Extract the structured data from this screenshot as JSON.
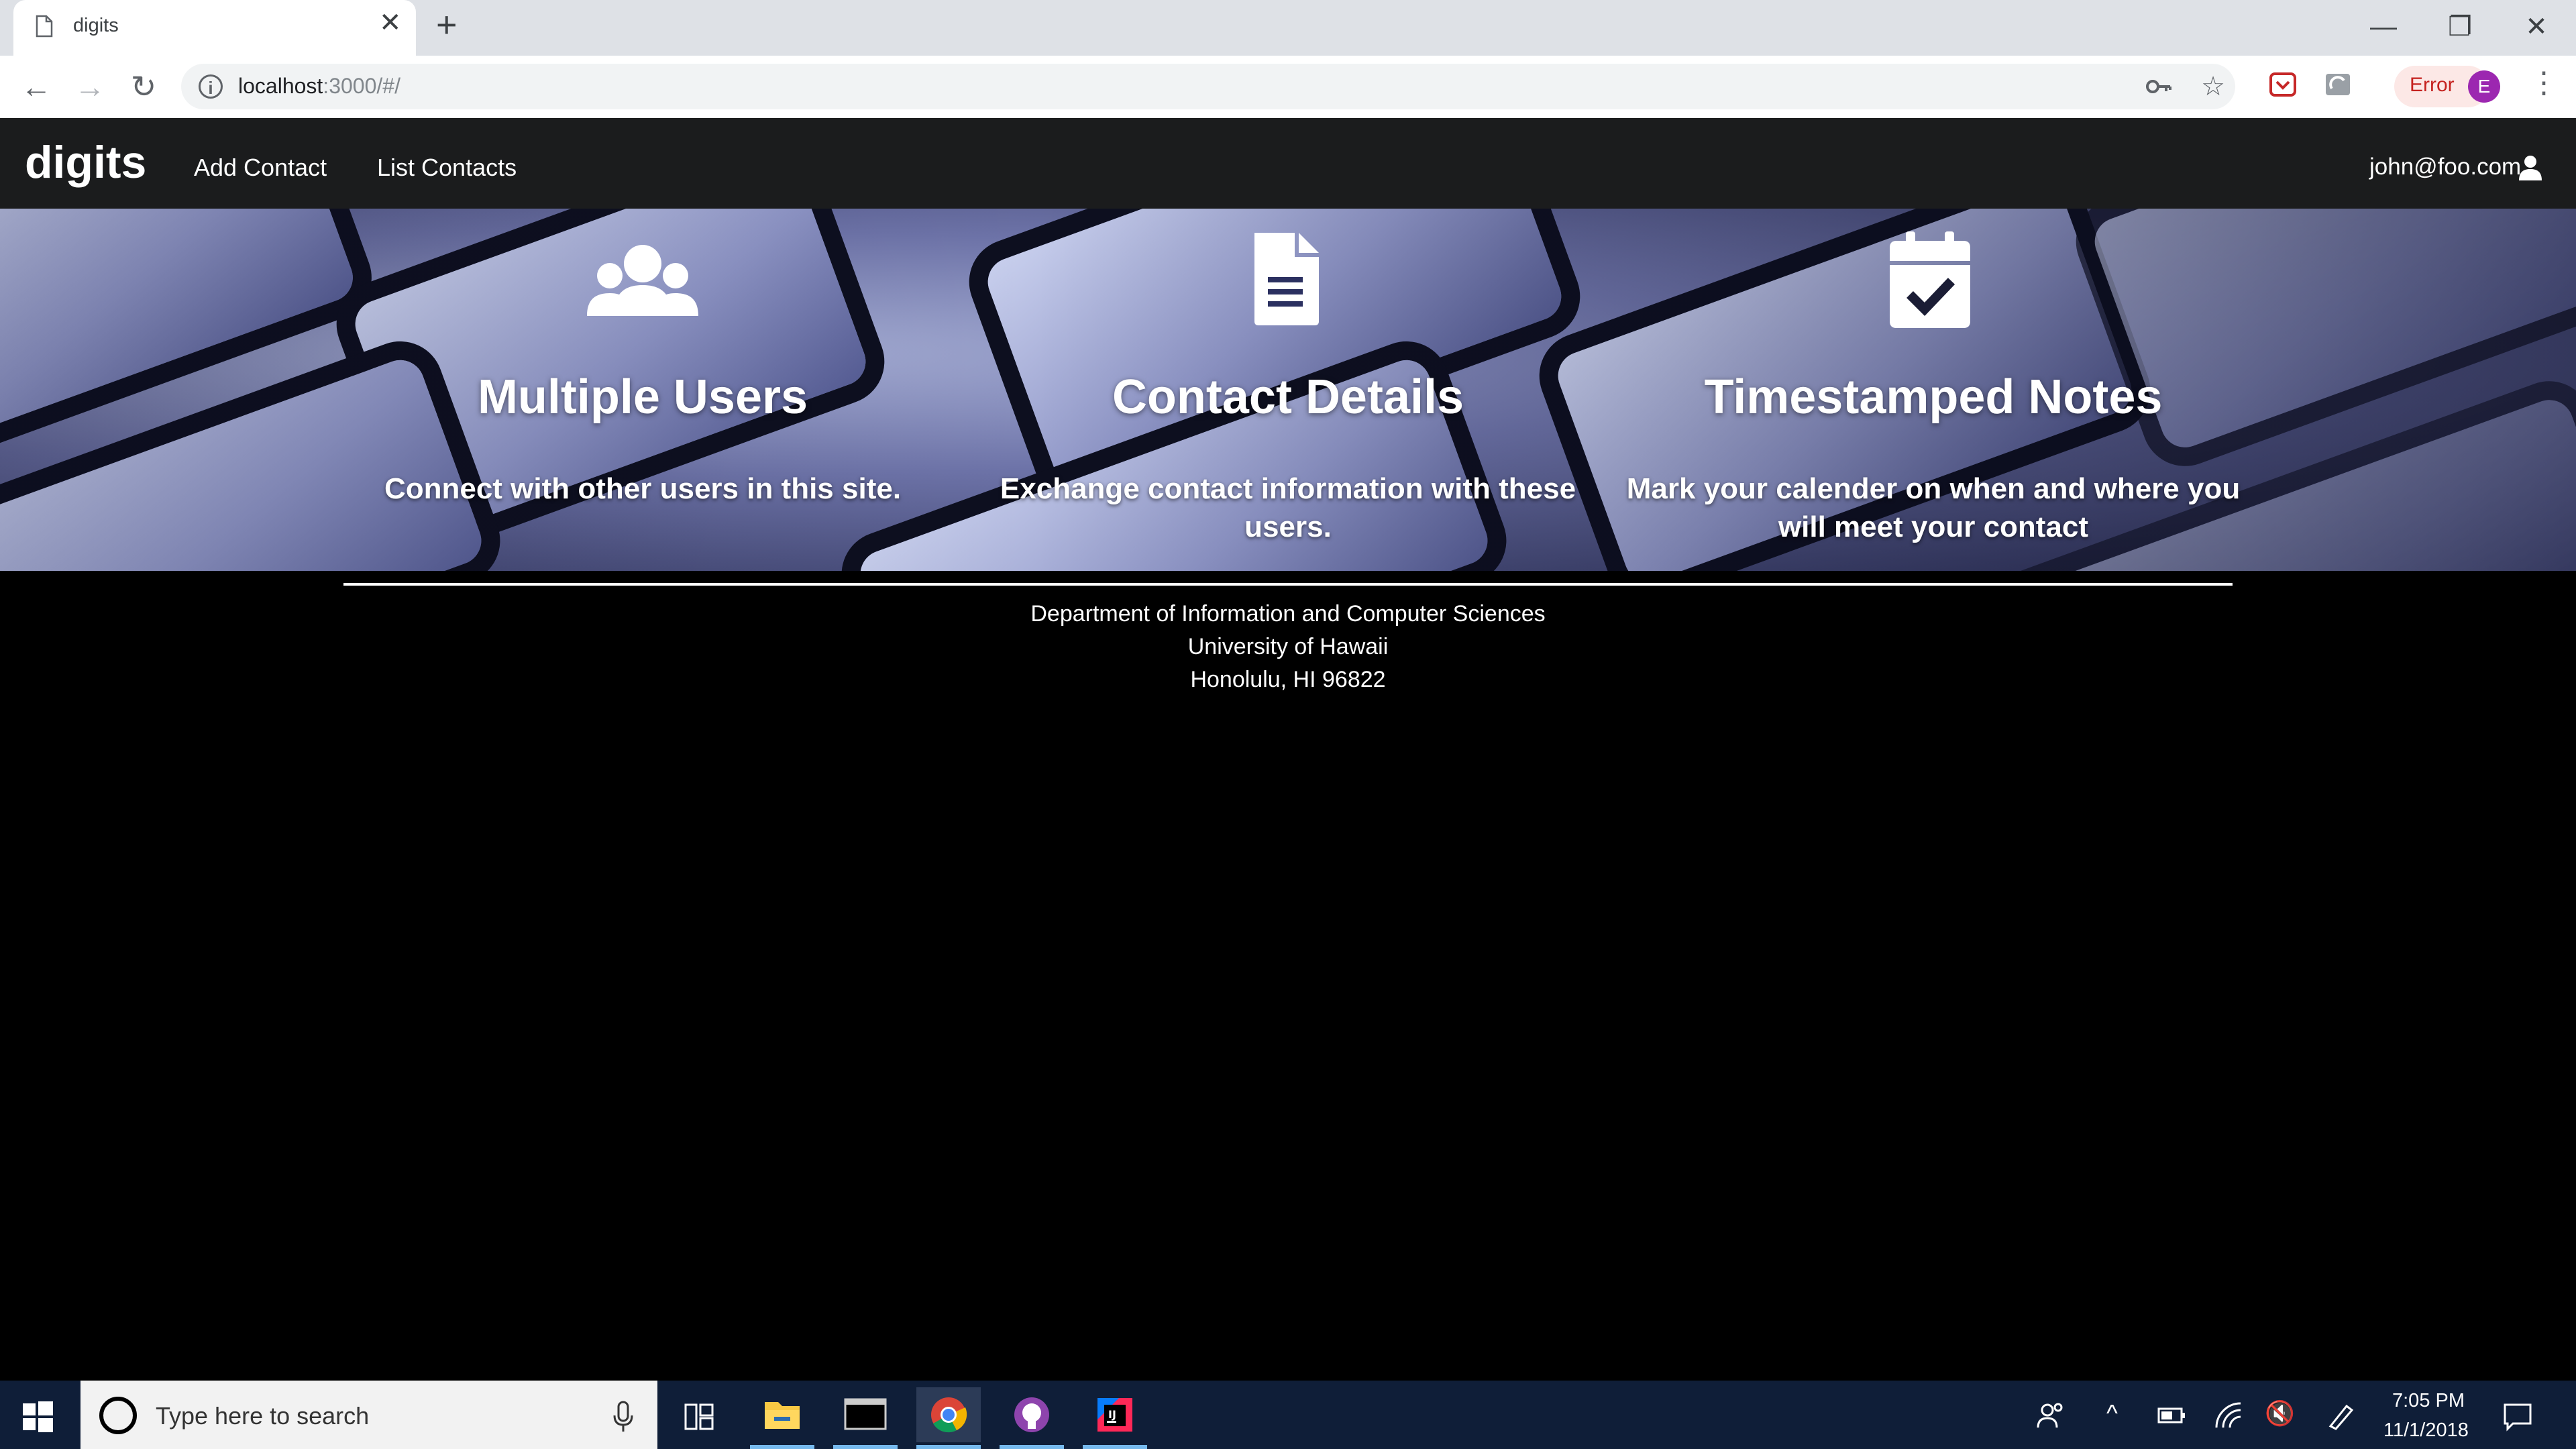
{
  "browser": {
    "tab_title": "digits",
    "new_tab_glyph": "+",
    "close_tab_glyph": "✕",
    "url_host": "localhost",
    "url_path": ":3000/#/",
    "error_label": "Error",
    "profile_initial": "E",
    "window_controls": {
      "minimize": "—",
      "restore": "❐",
      "close": "✕"
    }
  },
  "navbar": {
    "brand": "digits",
    "links": [
      "Add Contact",
      "List Contacts"
    ],
    "user": "john@foo.com"
  },
  "features": [
    {
      "icon": "users-icon",
      "title": "Multiple Users",
      "desc": "Connect with other users in this site."
    },
    {
      "icon": "document-icon",
      "title": "Contact Details",
      "desc_line1": "Exchange contact information with these",
      "desc_line2": "users."
    },
    {
      "icon": "calendar-check-icon",
      "title": "Timestamped Notes",
      "desc_line1": "Mark your calender on when and where you",
      "desc_line2": "will meet your contact"
    }
  ],
  "footer": {
    "line1": "Department of Information and Computer Sciences",
    "line2": "University of Hawaii",
    "line3": "Honolulu, HI 96822"
  },
  "taskbar": {
    "search_placeholder": "Type here to search",
    "time": "7:05 PM",
    "date": "11/1/2018"
  },
  "colors": {
    "navbar_bg": "#1b1c1d",
    "page_bg": "#000000",
    "taskbar_bg": "#0f1e38",
    "error_red": "#c5221f",
    "profile_purple": "#9c27b0"
  }
}
